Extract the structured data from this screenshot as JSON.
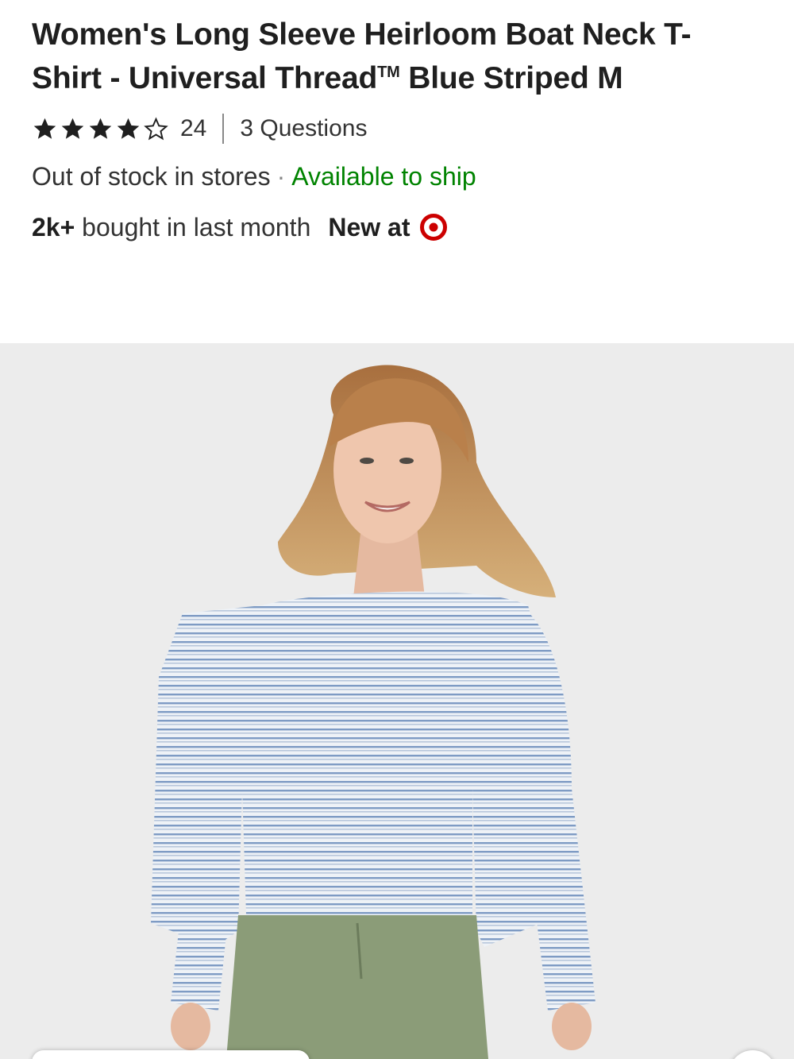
{
  "product": {
    "title_main": "Women's Long Sleeve Heirloom Boat Neck T-Shirt - Universal Thread",
    "title_tm": "TM",
    "title_tail": " Blue Striped M"
  },
  "rating": {
    "value": 4,
    "max": 5,
    "count": "24",
    "questions": "3 Questions"
  },
  "availability": {
    "store_status": "Out of stock in stores",
    "separator": "·",
    "ship_status": "Available to ship",
    "ship_color": "#008300"
  },
  "popularity": {
    "bought_count": "2k+",
    "bought_text": " bought in last month",
    "new_at": "New at",
    "brand_icon": "target-bullseye-icon",
    "brand_color": "#cc0000"
  },
  "media": {
    "image_description_icon": "product-photo",
    "background": "#ececec"
  }
}
